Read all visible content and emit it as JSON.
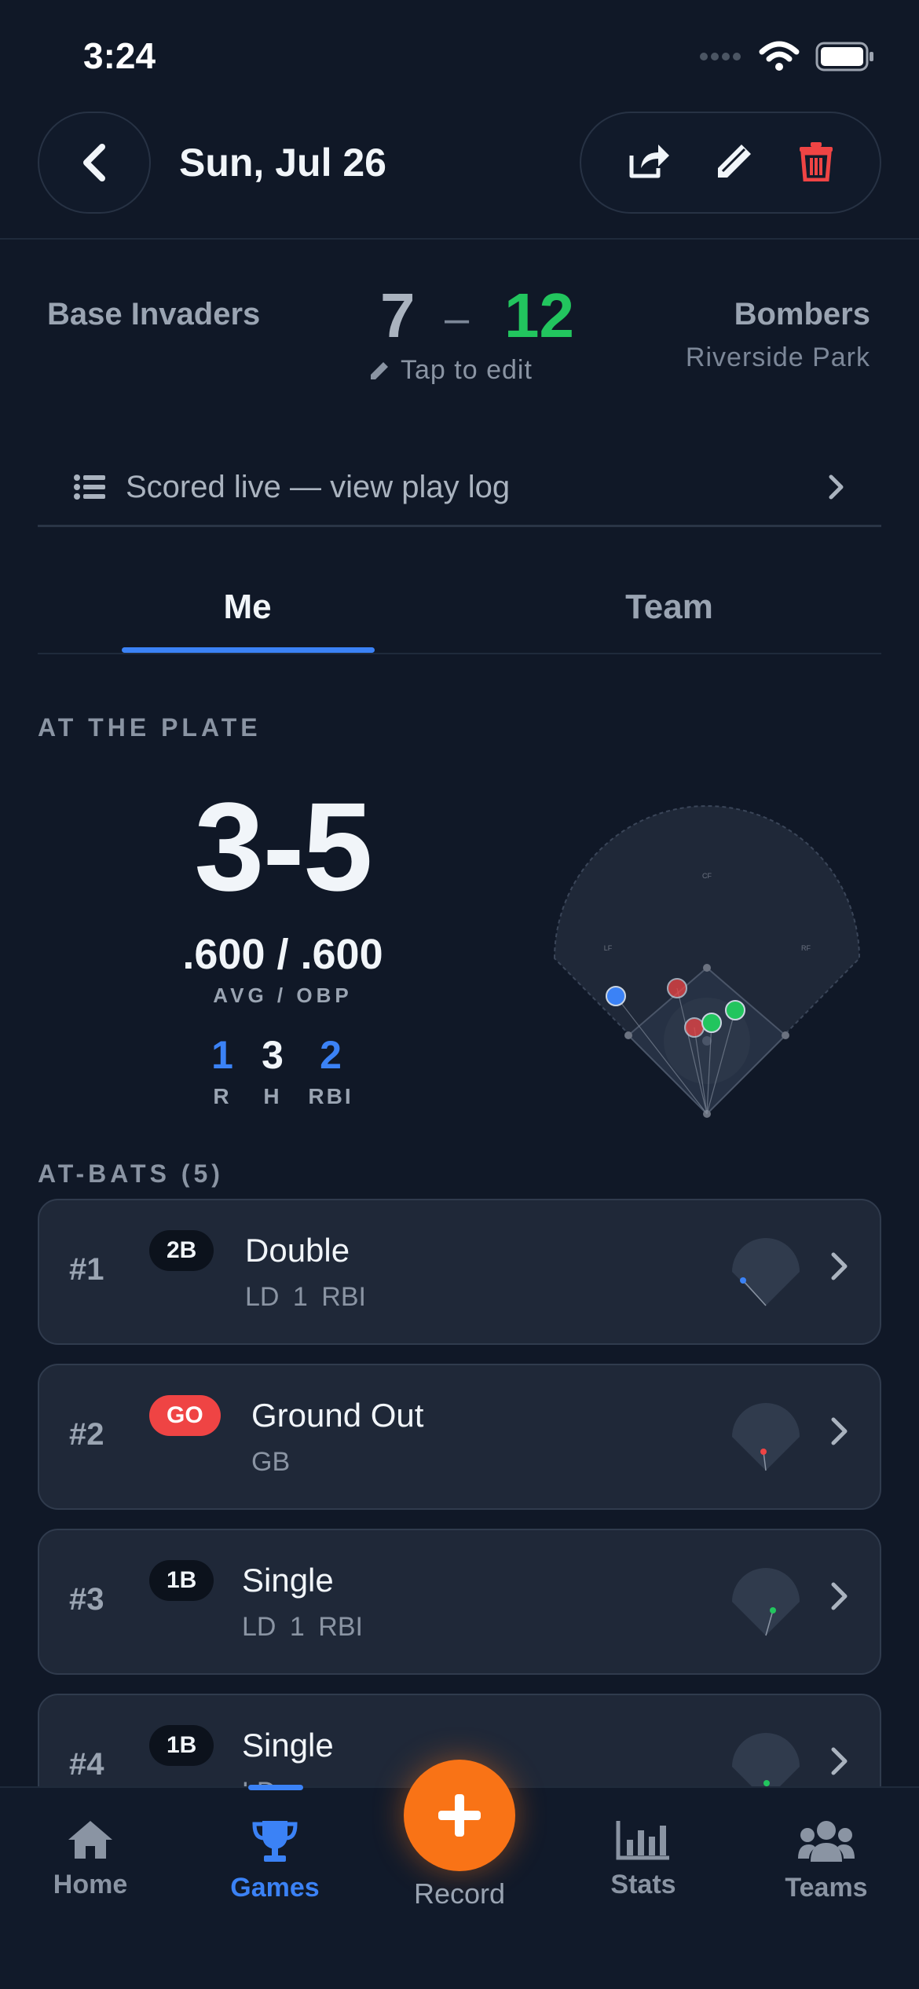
{
  "status_bar": {
    "time": "3:24"
  },
  "header": {
    "title": "Sun, Jul 26"
  },
  "game": {
    "away_team": "Base Invaders",
    "home_team": "Bombers",
    "venue": "Riverside Park",
    "away_score": "7",
    "dash": "–",
    "home_score": "12",
    "tap_to_edit": "Tap to edit",
    "colors": {
      "home_score": "#22c55e",
      "accent": "#3b82f6",
      "fab": "#f97316",
      "delete": "#ef4444"
    }
  },
  "play_log": {
    "label": "Scored live — view play log"
  },
  "tabs": [
    {
      "label": "Me",
      "active": true
    },
    {
      "label": "Team",
      "active": false
    }
  ],
  "at_the_plate": {
    "title": "AT THE PLATE",
    "line": "3-5",
    "avg_obp": ".600 / .600",
    "avg_obp_label": "AVG / OBP",
    "stats": [
      {
        "value": "1",
        "label": "R"
      },
      {
        "value": "3",
        "label": "H"
      },
      {
        "value": "2",
        "label": "RBI"
      }
    ],
    "field_labels": {
      "cf": "CF",
      "lf": "LF",
      "rf": "RF"
    }
  },
  "at_bats": {
    "title": "AT-BATS (5)",
    "items": [
      {
        "num": "#1",
        "badge": "2B",
        "title": "Double",
        "sub": "LD 1 RBI"
      },
      {
        "num": "#2",
        "badge": "GO",
        "title": "Ground Out",
        "sub": "GB"
      },
      {
        "num": "#3",
        "badge": "1B",
        "title": "Single",
        "sub": "LD 1 RBI"
      },
      {
        "num": "#4",
        "badge": "1B",
        "title": "Single",
        "sub": "LD"
      }
    ]
  },
  "nav": {
    "home": "Home",
    "games": "Games",
    "record": "Record",
    "stats": "Stats",
    "teams": "Teams"
  }
}
